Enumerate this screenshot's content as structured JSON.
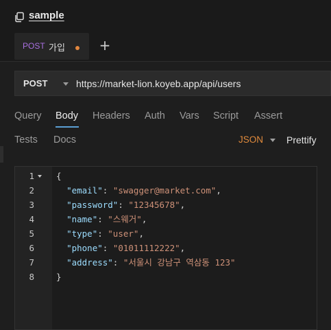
{
  "collection": {
    "title": "sample",
    "icon": "copy-icon"
  },
  "tabs": [
    {
      "method": "POST",
      "name": "가입",
      "unsaved": true
    }
  ],
  "new_tab_label": "+",
  "request": {
    "method": "POST",
    "url": "https://market-lion.koyeb.app/api/users"
  },
  "pane_tabs": {
    "row1": [
      "Query",
      "Body",
      "Headers",
      "Auth",
      "Vars",
      "Script",
      "Assert"
    ],
    "row2": [
      "Tests",
      "Docs"
    ],
    "active": "Body"
  },
  "body_mode": "JSON",
  "prettify_label": "Prettify",
  "editor": {
    "lines": [
      {
        "num": "1",
        "fold": true,
        "tokens": [
          {
            "t": "p",
            "v": "{"
          }
        ]
      },
      {
        "num": "2",
        "tokens": [
          {
            "t": "p",
            "v": "  "
          },
          {
            "t": "k",
            "v": "\"email\""
          },
          {
            "t": "p",
            "v": ": "
          },
          {
            "t": "s",
            "v": "\"swagger@market.com\""
          },
          {
            "t": "p",
            "v": ","
          }
        ]
      },
      {
        "num": "3",
        "tokens": [
          {
            "t": "p",
            "v": "  "
          },
          {
            "t": "k",
            "v": "\"password\""
          },
          {
            "t": "p",
            "v": ": "
          },
          {
            "t": "s",
            "v": "\"12345678\""
          },
          {
            "t": "p",
            "v": ","
          }
        ]
      },
      {
        "num": "4",
        "tokens": [
          {
            "t": "p",
            "v": "  "
          },
          {
            "t": "k",
            "v": "\"name\""
          },
          {
            "t": "p",
            "v": ": "
          },
          {
            "t": "s",
            "v": "\"스웨거\""
          },
          {
            "t": "p",
            "v": ","
          }
        ]
      },
      {
        "num": "5",
        "tokens": [
          {
            "t": "p",
            "v": "  "
          },
          {
            "t": "k",
            "v": "\"type\""
          },
          {
            "t": "p",
            "v": ": "
          },
          {
            "t": "s",
            "v": "\"user\""
          },
          {
            "t": "p",
            "v": ","
          }
        ]
      },
      {
        "num": "6",
        "tokens": [
          {
            "t": "p",
            "v": "  "
          },
          {
            "t": "k",
            "v": "\"phone\""
          },
          {
            "t": "p",
            "v": ": "
          },
          {
            "t": "s",
            "v": "\"01011112222\""
          },
          {
            "t": "p",
            "v": ","
          }
        ]
      },
      {
        "num": "7",
        "tokens": [
          {
            "t": "p",
            "v": "  "
          },
          {
            "t": "k",
            "v": "\"address\""
          },
          {
            "t": "p",
            "v": ": "
          },
          {
            "t": "s",
            "v": "\"서울시 강남구 역삼동 123\""
          }
        ]
      },
      {
        "num": "8",
        "tokens": [
          {
            "t": "p",
            "v": "}"
          }
        ]
      }
    ]
  },
  "colors": {
    "post_method": "#a970e0",
    "unsaved_dot": "#e2873f",
    "active_tab_underline": "#5b9fd4",
    "body_mode": "#e08a3c",
    "json_key": "#9cdcfe",
    "json_string": "#ce9178"
  }
}
